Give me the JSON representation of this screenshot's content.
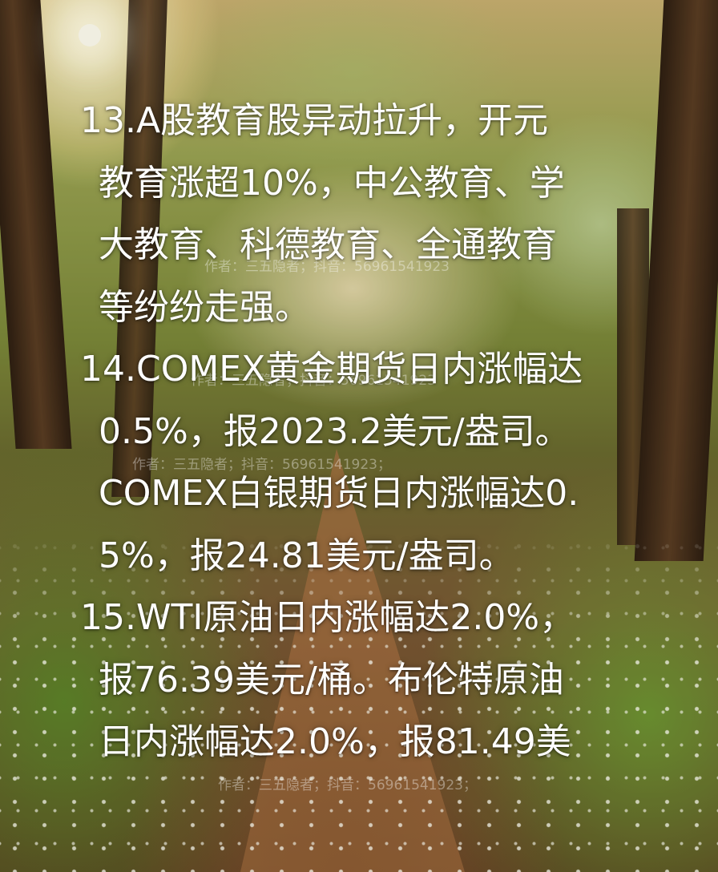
{
  "content": {
    "lines": [
      "13.A股教育股异动拉升，开元",
      "教育涨超10%，中公教育、学",
      "大教育、科德教育、全通教育",
      "等纷纷走强。",
      "14.COMEX黄金期货日内涨幅达",
      "0.5%，报2023.2美元/盎司。",
      "COMEX白银期货日内涨幅达0.",
      "5%，报24.81美元/盎司。",
      "15.WTI原油日内涨幅达2.0%，",
      "报76.39美元/桶。布伦特原油",
      "日内涨幅达2.0%，报81.49美"
    ]
  },
  "watermarks": [
    "作者：三五隐者；抖音：56961541923",
    "作者：三五隐者；抖音：56961541923",
    "作者：三五隐者；抖音：56961541923；",
    "作者：三五隐者；抖音：56961541923；"
  ],
  "colors": {
    "text": "#ffffff"
  }
}
